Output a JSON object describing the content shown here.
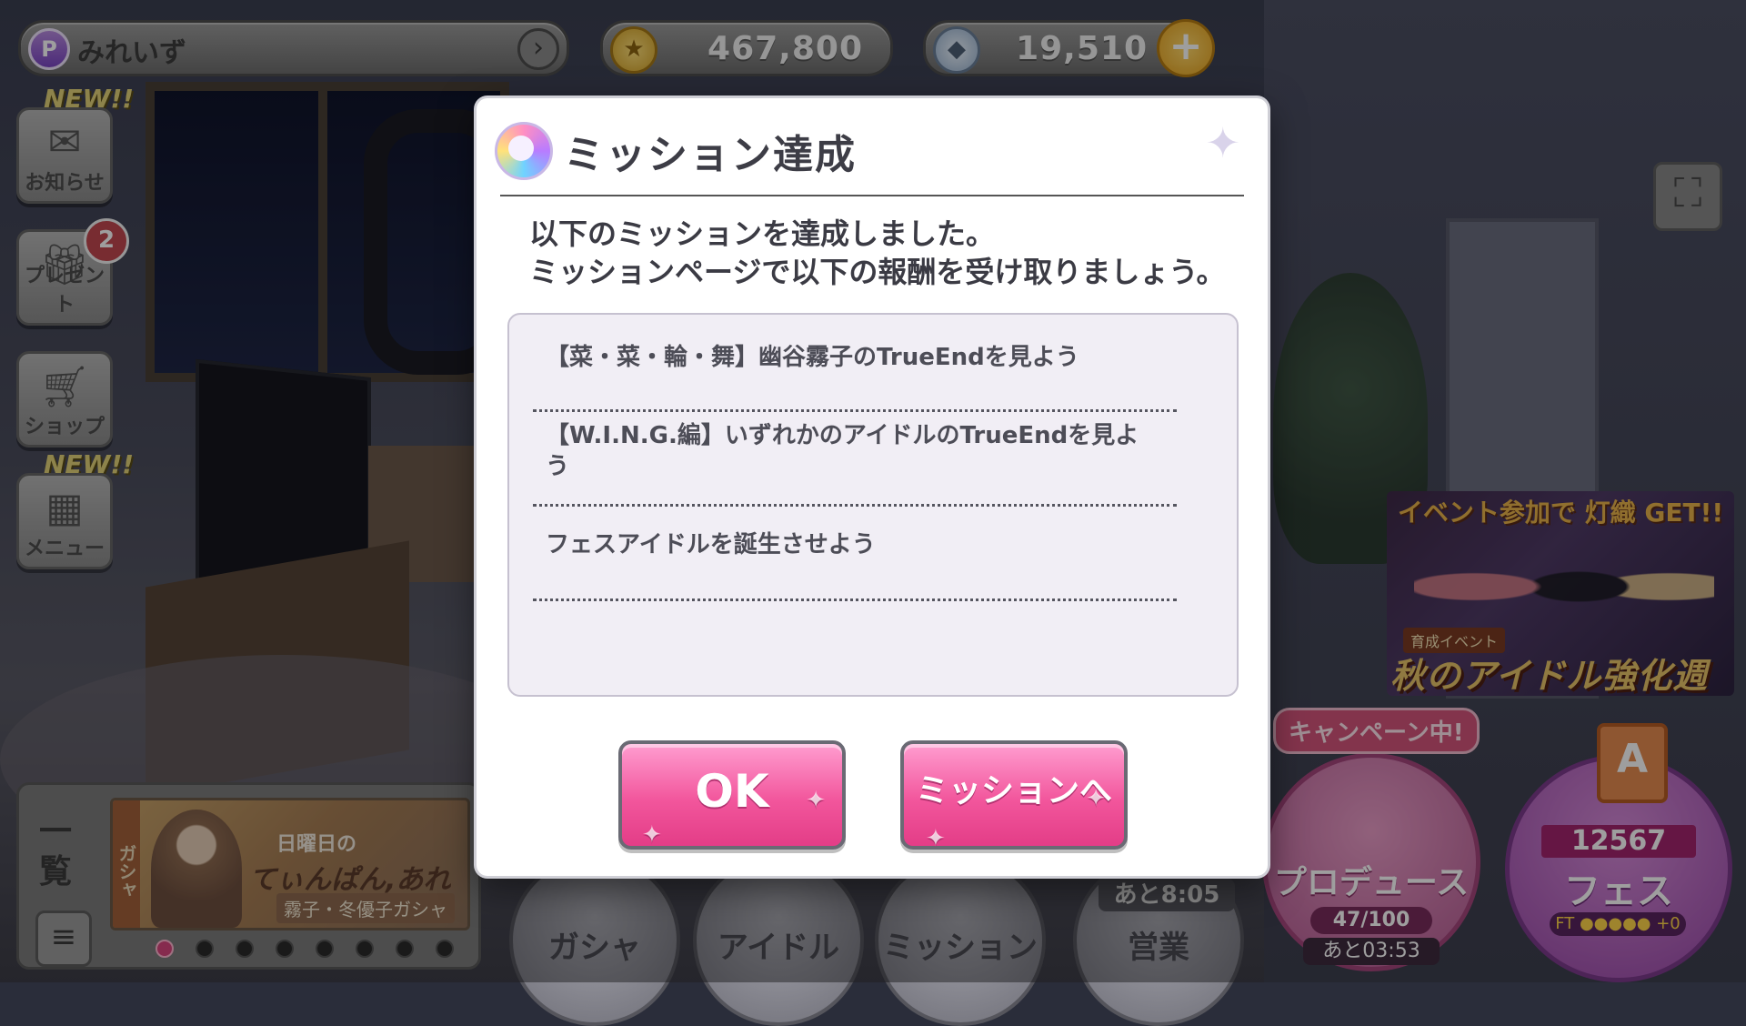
{
  "player": {
    "name": "みれいず",
    "badge": "P"
  },
  "currency": {
    "coins": "467,800",
    "gems": "19,510"
  },
  "side_menu": {
    "new_tag": "NEW!!",
    "items": [
      {
        "label": "お知らせ",
        "icon": "mail-icon"
      },
      {
        "label": "プレゼント",
        "icon": "gift-icon",
        "badge": "2"
      },
      {
        "label": "ショップ",
        "icon": "cart-icon"
      },
      {
        "label": "メニュー",
        "icon": "grid-icon"
      }
    ]
  },
  "gacha": {
    "list_label": "一覧",
    "side": "ガシャ",
    "title": "日曜日の",
    "headline": "てぃんぱん,あれ",
    "sub": "霧子・冬優子ガシャ",
    "dots": 8,
    "active_dot": 0
  },
  "event": {
    "top": "イベント参加で 灯織 GET!!",
    "sub": "育成イベント",
    "main": "秋のアイドル強化週間"
  },
  "bottom_nav": {
    "items": [
      "ガシャ",
      "アイドル",
      "ミッション",
      "営業"
    ],
    "eigyo_timer": "あと8:05",
    "campaign": "キャンペーン中!",
    "produce": {
      "label": "プロデュース",
      "progress": "47/100",
      "timer": "あと03:53"
    },
    "fes": {
      "label": "フェス",
      "rank": "A",
      "score": "12567",
      "ft": "FT ●●●●● +0"
    }
  },
  "modal": {
    "title": "ミッション達成",
    "message_lines": [
      "以下のミッションを達成しました。",
      "ミッションページで以下の報酬を受け取りましょう。"
    ],
    "missions": [
      "【菜・菜・輪・舞】幽谷霧子のTrueEndを見よう",
      "【W.I.N.G.編】いずれかのアイドルのTrueEndを見よ",
      "う",
      "フェスアイドルを誕生させよう"
    ],
    "ok_label": "OK",
    "mission_label": "ミッションへ"
  },
  "colors": {
    "accent_pink": "#f2569c",
    "badge_red": "#c2484f"
  }
}
